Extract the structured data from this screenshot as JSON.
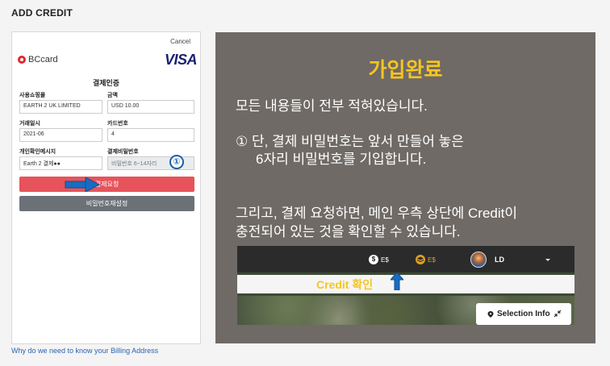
{
  "page_title": "ADD CREDIT",
  "payment_form": {
    "cancel": "Cancel",
    "card_brand": "BCcard",
    "visa": "VISA",
    "form_title": "결제인증",
    "fields": {
      "merchant_label": "사용쇼핑몰",
      "merchant_value": "EARTH 2 UK LIMITED",
      "amount_label": "금액",
      "amount_value": "USD 10.00",
      "date_label": "거래일시",
      "date_value": "2021-06",
      "card_label": "카드번호",
      "card_value": "4",
      "message_label": "개인확인메시지",
      "message_value": "Earth 2 결제●●",
      "password_label": "결제비밀번호",
      "password_placeholder": "비밀번호 6~14자리"
    },
    "step_marker": "①",
    "pay_button": "결제요청",
    "reset_button": "비밀번호재설정"
  },
  "billing_link": "Why do we need to know your Billing Address",
  "info_panel": {
    "heading": "가입완료",
    "line1": "모든 내용들이 전부 적혀있습니다.",
    "line2": "① 단, 결제 비밀번호는 앞서 만들어 놓은",
    "line3": "6자리 비밀번호를 기입합니다.",
    "line4": "그리고, 결제 요청하면, 메인 우측 상단에 Credit이",
    "line5": "충전되어 있는 것을 확인할 수 있습니다."
  },
  "app_screenshot": {
    "currency1": "E$",
    "currency1_icon": "$",
    "currency2": "E$",
    "user_name": "LD",
    "credit_label": "Credit 확인",
    "selection_info": "Selection Info"
  },
  "colors": {
    "accent_yellow": "#f7c520",
    "pay_red": "#e7535b",
    "marker_blue": "#1a5ea8"
  }
}
